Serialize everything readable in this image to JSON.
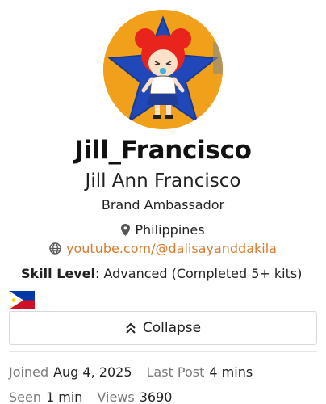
{
  "profile": {
    "username": "Jill_Francisco",
    "full_name": "Jill Ann Francisco",
    "title": "Brand Ambassador",
    "location": "Philippines",
    "website": "youtube.com/@dalisayanddakila",
    "skill_label": "Skill Level",
    "skill_value": ": Advanced (Completed 5+ kits)"
  },
  "icons": {
    "location": "map-pin-icon",
    "website": "globe-icon",
    "collapse": "double-chevron-up-icon",
    "flag": "philippines-flag"
  },
  "actions": {
    "collapse_label": "Collapse"
  },
  "stats": {
    "joined_label": "Joined",
    "joined_value": "Aug 4, 2025",
    "last_post_label": "Last Post",
    "last_post_value": "4 mins",
    "seen_label": "Seen",
    "seen_value": "1 min",
    "views_label": "Views",
    "views_value": "3690"
  },
  "colors": {
    "link": "#d97b2d",
    "avatar_bg": "#f0a01a",
    "avatar_star": "#2148b8"
  }
}
